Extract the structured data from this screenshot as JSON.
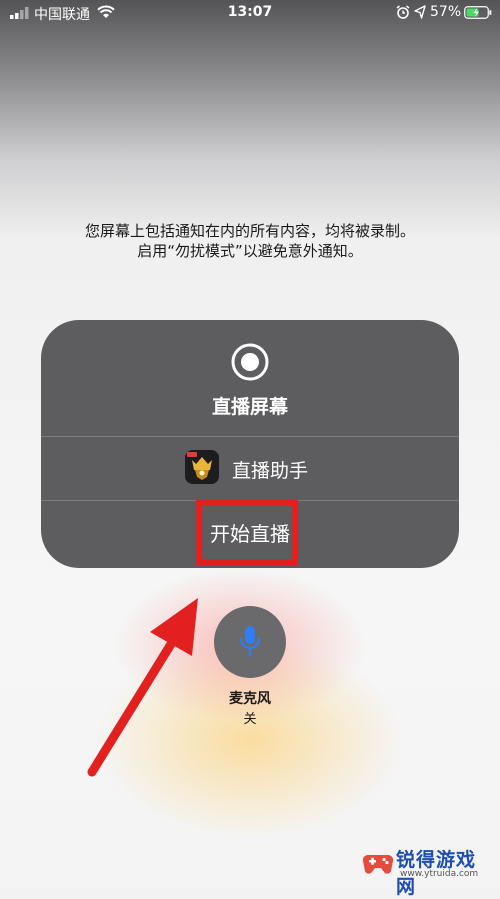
{
  "status_bar": {
    "carrier": "中国联通",
    "time": "13:07",
    "battery": "57%"
  },
  "info": {
    "line1": "您屏幕上包括通知在内的所有内容，均将被录制。",
    "line2": "启用“勿扰模式”以避免意外通知。"
  },
  "card": {
    "title": "直播屏幕",
    "app_name": "直播助手",
    "start_label": "开始直播"
  },
  "mic": {
    "label": "麦克风",
    "state": "关"
  },
  "watermark": {
    "text": "锐得游戏网",
    "url": "www.ytruida.com"
  },
  "colors": {
    "card_bg": "#5d5d5f",
    "highlight": "#e32020",
    "mic_icon": "#2f7df6",
    "battery": "#4cd964"
  },
  "icons": {
    "record": "record-icon",
    "mic": "microphone-icon",
    "wifi": "wifi-icon",
    "alarm": "alarm-icon",
    "location": "location-arrow-icon",
    "battery": "battery-charging-icon"
  }
}
